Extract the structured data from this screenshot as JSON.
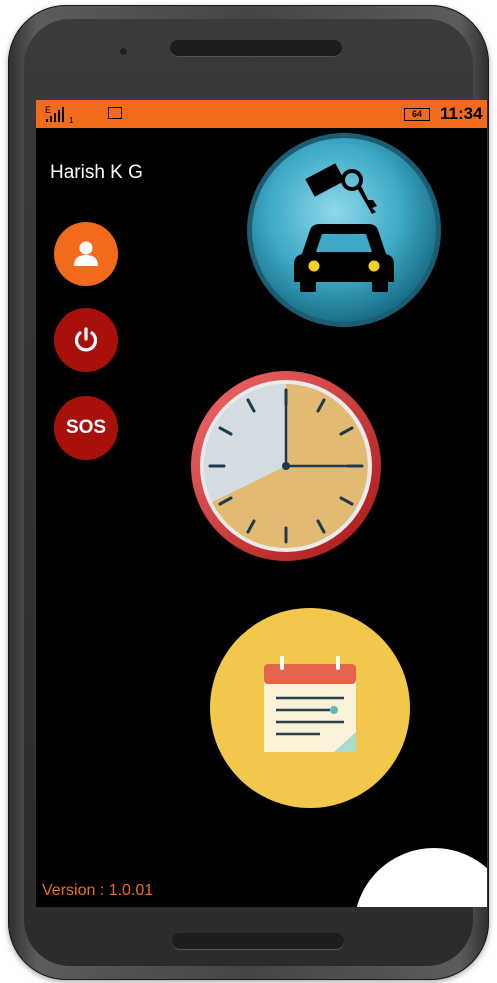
{
  "status_bar": {
    "network_label": "E",
    "sim_label": "1",
    "battery_level": "64",
    "time": "11:34"
  },
  "user": {
    "name": "Harish K G"
  },
  "sidebar": {
    "sos_label": "SOS"
  },
  "footer": {
    "version": "Version : 1.0.01"
  },
  "colors": {
    "accent": "#f26b1c",
    "danger": "#a8100b",
    "background": "#000000",
    "car_tile": "#3aa7c4",
    "notes_tile": "#f1c84b"
  }
}
